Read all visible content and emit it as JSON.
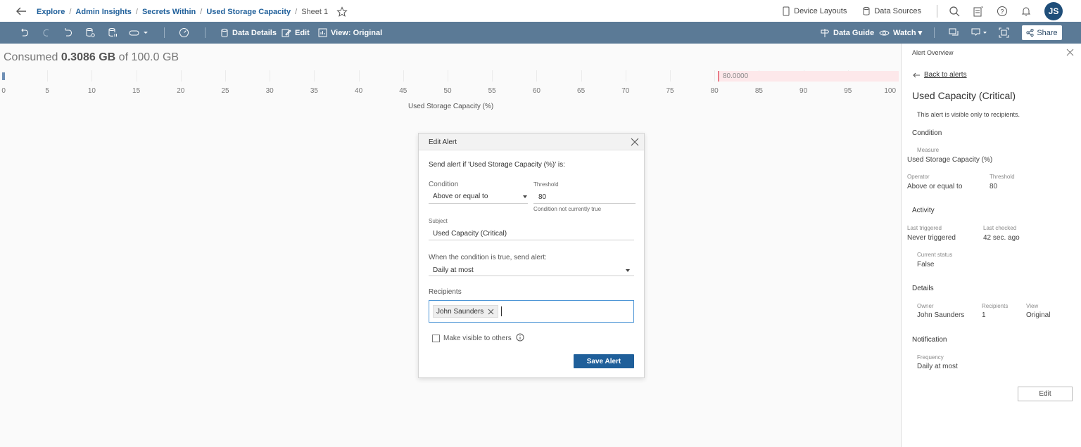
{
  "breadcrumb": {
    "items": [
      "Explore",
      "Admin Insights",
      "Secrets Within",
      "Used Storage Capacity"
    ],
    "current": "Sheet 1"
  },
  "topbar": {
    "device_layouts": "Device Layouts",
    "data_sources": "Data Sources",
    "avatar_initials": "JS"
  },
  "toolbar": {
    "data_details": "Data Details",
    "edit": "Edit",
    "view": "View: Original",
    "data_guide": "Data Guide",
    "watch": "Watch ▾",
    "share": "Share"
  },
  "viz": {
    "consumed_prefix": "Consumed ",
    "consumed_value": "0.3086 GB",
    "consumed_suffix": " of 100.0 GB",
    "reference_label": "80.0000",
    "axis_title": "Used Storage Capacity (%)"
  },
  "chart_data": {
    "type": "bar",
    "orientation": "horizontal",
    "values": [
      0.3086
    ],
    "xlabel": "Used Storage Capacity (%)",
    "xlim": [
      0,
      100
    ],
    "ticks": [
      "0",
      "5",
      "10",
      "15",
      "20",
      "25",
      "30",
      "35",
      "40",
      "45",
      "50",
      "55",
      "60",
      "65",
      "70",
      "75",
      "80",
      "85",
      "90",
      "95",
      "100"
    ],
    "reference_line": 80,
    "reference_band": [
      80,
      100
    ],
    "grid": true,
    "colors": {
      "bar": "#6e8fb5",
      "reference_line": "#e87c89",
      "reference_band": "#fde8ea"
    }
  },
  "dialog": {
    "title": "Edit Alert",
    "intro": "Send alert if 'Used Storage Capacity (%)' is:",
    "condition_label": "Condition",
    "condition_value": "Above or equal to",
    "threshold_label": "Threshold",
    "threshold_value": "80",
    "threshold_note": "Condition not currently true",
    "subject_label": "Subject",
    "subject_value": "Used Capacity (Critical)",
    "frequency_label": "When the condition is true, send alert:",
    "frequency_value": "Daily at most",
    "recipients_label": "Recipients",
    "recipient": "John Saunders",
    "visible_label": "Make visible to others",
    "save_label": "Save Alert"
  },
  "panel": {
    "title": "Alert Overview",
    "back": "Back to alerts",
    "alert_name": "Used Capacity (Critical)",
    "visibility": "This alert is visible only to recipients.",
    "condition_section": "Condition",
    "measure_label": "Measure",
    "measure_value": "Used Storage Capacity (%)",
    "operator_label": "Operator",
    "operator_value": "Above or equal to",
    "threshold_label": "Threshold",
    "threshold_value": "80",
    "activity_section": "Activity",
    "last_triggered_label": "Last triggered",
    "last_triggered_value": "Never triggered",
    "last_checked_label": "Last checked",
    "last_checked_value": "42 sec. ago",
    "status_label": "Current status",
    "status_value": "False",
    "details_section": "Details",
    "owner_label": "Owner",
    "owner_value": "John Saunders",
    "recipients_label": "Recipients",
    "recipients_value": "1",
    "view_label": "View",
    "view_value": "Original",
    "notification_section": "Notification",
    "frequency_label": "Frequency",
    "frequency_value": "Daily at most",
    "edit_label": "Edit"
  }
}
